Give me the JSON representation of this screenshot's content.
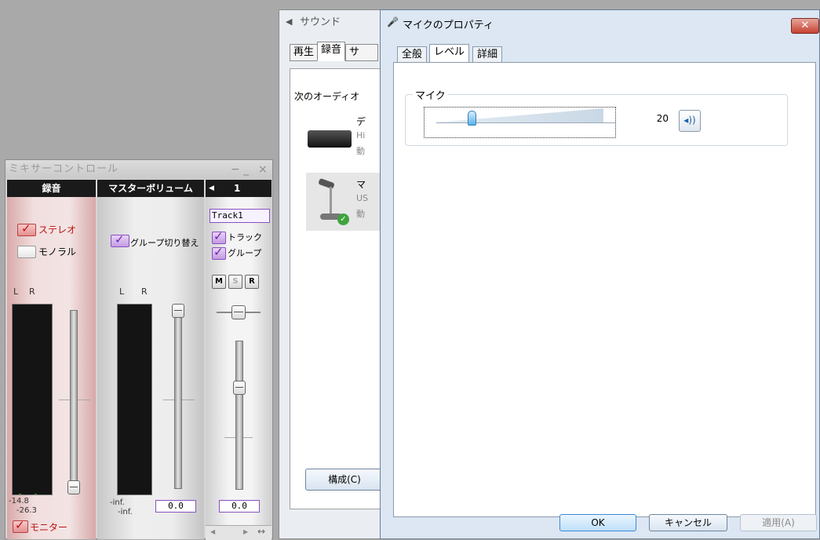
{
  "mixer": {
    "title": "ミキサーコントロール",
    "window_controls": {
      "pin": "−",
      "minimize": "_",
      "close": "×"
    },
    "rec_column": {
      "header": "録音",
      "stereo_label": "ステレオ",
      "mono_label": "モノラル",
      "l": "L",
      "r": "R",
      "level_left": "-14.8",
      "level_right": "-26.3",
      "monitor_label": "モニター"
    },
    "master_column": {
      "header": "マスターボリューム",
      "group_switch_label": "グループ切り替え",
      "l": "L",
      "r": "R",
      "level_left": "-inf.",
      "level_right": "-inf.",
      "value": "0.0"
    },
    "track_column": {
      "header_arrow": "◀",
      "header_num": "1",
      "name": "Track1",
      "track_label": "トラック",
      "group_label": "グループ",
      "m": "M",
      "s": "S",
      "r": "R",
      "value": "0.0",
      "scroll_left": "◀",
      "scroll_right": "▶",
      "resize": "↔"
    }
  },
  "sound": {
    "title": "サウンド",
    "tabs": [
      "再生",
      "録音",
      "サ"
    ],
    "instruction": "次のオーディオ",
    "devices": [
      {
        "name": "デ",
        "desc": "Hi",
        "status": "動"
      },
      {
        "name": "マ",
        "desc": "US",
        "status": "動"
      }
    ],
    "configure_button": "構成(C)"
  },
  "dialog": {
    "title": "マイクのプロパティ",
    "close": "✕",
    "tabs": [
      "全般",
      "レベル",
      "詳細"
    ],
    "active_tab": "レベル",
    "group_label": "マイク",
    "level_value": "20",
    "level_fraction": 0.2,
    "mute_icon": "◂))",
    "ok_button": "OK",
    "cancel_button": "キャンセル",
    "apply_button": "適用(A)"
  },
  "colors": {
    "rec_accent": "#c01010",
    "group_accent": "#6c22b0",
    "meter_green": "#2aa02a",
    "dialog_bg": "#dce7f3"
  }
}
